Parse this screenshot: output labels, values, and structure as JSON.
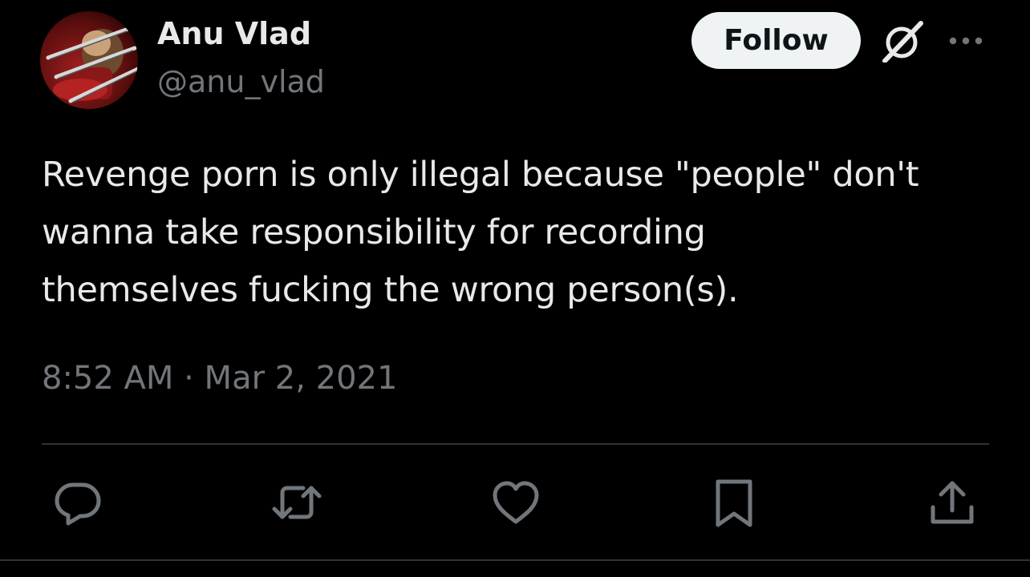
{
  "author": {
    "name": "Anu Vlad",
    "handle": "@anu_vlad",
    "avatar_icon": "avatar-image"
  },
  "header": {
    "follow_label": "Follow",
    "grok_icon": "grok-icon",
    "more_icon": "more-icon"
  },
  "tweet": {
    "lines": [
      "Revenge porn is only illegal because \"people\" don't",
      "wanna take responsibility for recording",
      "themselves fucking the wrong person(s)."
    ],
    "timestamp": "8:52 AM · Mar 2, 2021"
  },
  "actions": [
    {
      "name": "reply",
      "icon": "reply-icon"
    },
    {
      "name": "retweet",
      "icon": "retweet-icon"
    },
    {
      "name": "like",
      "icon": "heart-icon"
    },
    {
      "name": "bookmark",
      "icon": "bookmark-icon"
    },
    {
      "name": "share",
      "icon": "share-icon"
    }
  ],
  "colors": {
    "background": "#000000",
    "text": "#e7e9ea",
    "muted": "#71767b",
    "divider": "#2f3336",
    "follow_bg": "#eff3f4"
  }
}
